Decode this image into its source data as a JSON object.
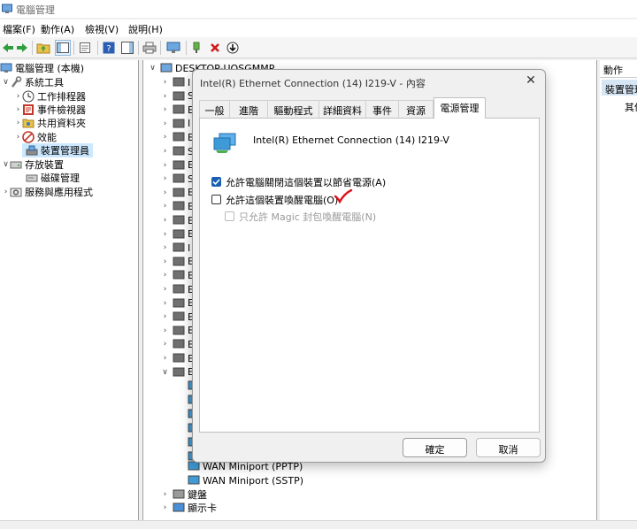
{
  "window": {
    "title": "電腦管理"
  },
  "menu": [
    "檔案(F)",
    "動作(A)",
    "檢視(V)",
    "說明(H)"
  ],
  "tree": {
    "root": "電腦管理 (本機)",
    "system_tools": "系統工具",
    "task_scheduler": "工作排程器",
    "event_viewer": "事件檢視器",
    "shared_folders": "共用資料夾",
    "performance": "效能",
    "device_manager": "裝置管理員",
    "storage": "存放裝置",
    "disk_management": "磁碟管理",
    "services": "服務與應用程式"
  },
  "devices": {
    "computer": "DESKTOP-UOSGMMP",
    "visible_items": [
      "WAN Miniport (PPTP)",
      "WAN Miniport (SSTP)",
      "鍵盤",
      "顯示卡"
    ],
    "partial_labels": [
      "I",
      "S",
      "E",
      "I",
      "E",
      "S",
      "E",
      "S",
      "E",
      "E",
      "E",
      "E",
      "I",
      "E",
      "E",
      "E",
      "E",
      "E",
      "E",
      "E",
      "E",
      "E"
    ]
  },
  "actions": {
    "header": "動作",
    "selected": "裝置管理員",
    "more": "其他"
  },
  "dialog": {
    "title": "Intel(R) Ethernet Connection (14) I219-V - 內容",
    "close": "✕",
    "tabs": [
      "一般",
      "進階",
      "驅動程式",
      "詳細資料",
      "事件",
      "資源",
      "電源管理"
    ],
    "active_tab": "電源管理",
    "device_name": "Intel(R) Ethernet Connection (14) I219-V",
    "options": {
      "allow_power_off": {
        "label": "允許電腦關閉這個裝置以節省電源(A)",
        "checked": true
      },
      "allow_wake": {
        "label": "允許這個裝置喚醒電腦(O)",
        "checked": false
      },
      "magic_packet_only": {
        "label": "只允許 Magic 封包喚醒電腦(N)",
        "checked": false,
        "disabled": true
      }
    },
    "ok": "確定",
    "cancel": "取消"
  },
  "colors": {
    "accent": "#1a5fb4",
    "annotation": "#e0101a",
    "selection": "#cce8ff"
  }
}
